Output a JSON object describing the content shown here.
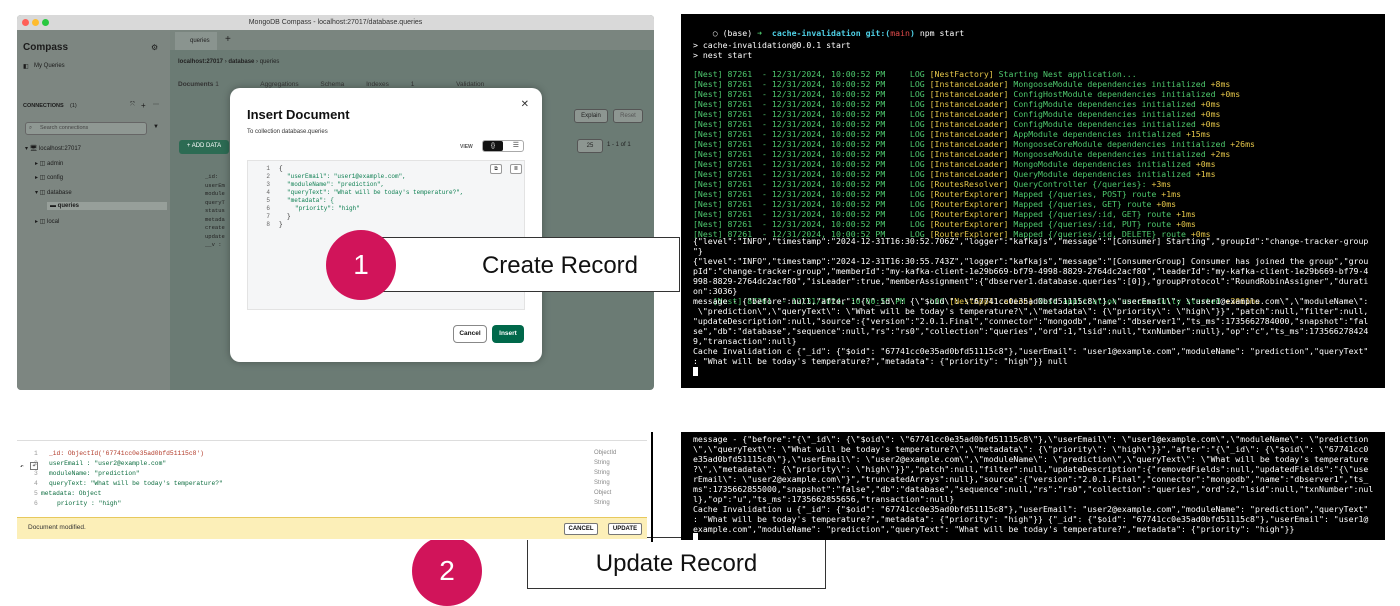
{
  "compass": {
    "window_title": "MongoDB Compass - localhost:27017/database.queries",
    "app_name": "Compass",
    "my_queries": "My Queries",
    "connections_label": "CONNECTIONS",
    "connections_count": "(1)",
    "search_placeholder": "Search connections",
    "tree": [
      "localhost:27017",
      "admin",
      "config",
      "database",
      "queries",
      "local"
    ],
    "tab": "queries",
    "breadcrumb": [
      "localhost:27017",
      "database",
      "queries"
    ],
    "subtabs": [
      "Documents",
      "1",
      "Aggregations",
      "Schema",
      "Indexes",
      "1",
      "Validation"
    ],
    "explain": "Explain",
    "reset": "Reset",
    "add_data": "ADD DATA",
    "page_size": "25",
    "page_info": "1 - 1 of 1",
    "bg_fields": [
      "_id:",
      "userEm",
      "module",
      "queryT",
      "status",
      "metada",
      "create",
      "update",
      "__v :"
    ]
  },
  "modal": {
    "title": "Insert Document",
    "subtitle": "To collection database.queries",
    "view_label": "VIEW",
    "view_json": "{}",
    "view_list": "☰",
    "line_numbers": [
      "1",
      "2",
      "3",
      "4",
      "5",
      "6",
      "7",
      "8"
    ],
    "code": [
      "{",
      "\"userEmail\": \"user1@example.com\",",
      "\"moduleName\": \"prediction\",",
      "\"queryText\": \"What will be today's temperature?\",",
      "\"metadata\": {",
      "\"priority\": \"high\"",
      "}",
      "}"
    ],
    "cancel": "Cancel",
    "insert": "Insert"
  },
  "labels": {
    "step1_num": "1",
    "step1_text": "Create Record",
    "step2_num": "2",
    "step2_text": "Update Record"
  },
  "terminal1": {
    "prompt_base": "(base)",
    "prompt_arrow": "➜",
    "prompt_dir": "cache-invalidation",
    "prompt_git": "git:(",
    "prompt_branch": "main",
    "prompt_git_end": ")",
    "prompt_cmd": "npm start",
    "out1": "> cache-invalidation@0.0.1 start",
    "out2": "> nest start",
    "logs": [
      [
        "[Nest] 87261  - 12/31/2024, 10:00:52 PM     LOG ",
        "[NestFactory]",
        " Starting Nest application...",
        ""
      ],
      [
        "[Nest] 87261  - 12/31/2024, 10:00:52 PM     LOG ",
        "[InstanceLoader]",
        " MongooseModule dependencies initialized",
        " +8ms"
      ],
      [
        "[Nest] 87261  - 12/31/2024, 10:00:52 PM     LOG ",
        "[InstanceLoader]",
        " ConfigHostModule dependencies initialized",
        " +0ms"
      ],
      [
        "[Nest] 87261  - 12/31/2024, 10:00:52 PM     LOG ",
        "[InstanceLoader]",
        " ConfigModule dependencies initialized",
        " +0ms"
      ],
      [
        "[Nest] 87261  - 12/31/2024, 10:00:52 PM     LOG ",
        "[InstanceLoader]",
        " ConfigModule dependencies initialized",
        " +0ms"
      ],
      [
        "[Nest] 87261  - 12/31/2024, 10:00:52 PM     LOG ",
        "[InstanceLoader]",
        " ConfigModule dependencies initialized",
        " +0ms"
      ],
      [
        "[Nest] 87261  - 12/31/2024, 10:00:52 PM     LOG ",
        "[InstanceLoader]",
        " AppModule dependencies initialized",
        " +15ms"
      ],
      [
        "[Nest] 87261  - 12/31/2024, 10:00:52 PM     LOG ",
        "[InstanceLoader]",
        " MongooseCoreModule dependencies initialized",
        " +26ms"
      ],
      [
        "[Nest] 87261  - 12/31/2024, 10:00:52 PM     LOG ",
        "[InstanceLoader]",
        " MongooseModule dependencies initialized",
        " +2ms"
      ],
      [
        "[Nest] 87261  - 12/31/2024, 10:00:52 PM     LOG ",
        "[InstanceLoader]",
        " MongoModule dependencies initialized",
        " +0ms"
      ],
      [
        "[Nest] 87261  - 12/31/2024, 10:00:52 PM     LOG ",
        "[InstanceLoader]",
        " QueryModule dependencies initialized",
        " +1ms"
      ],
      [
        "[Nest] 87261  - 12/31/2024, 10:00:52 PM     LOG ",
        "[RoutesResolver]",
        " QueryController {/queries}:",
        " +3ms"
      ],
      [
        "[Nest] 87261  - 12/31/2024, 10:00:52 PM     LOG ",
        "[RouterExplorer]",
        " Mapped {/queries, POST} route",
        " +1ms"
      ],
      [
        "[Nest] 87261  - 12/31/2024, 10:00:52 PM     LOG ",
        "[RouterExplorer]",
        " Mapped {/queries, GET} route",
        " +0ms"
      ],
      [
        "[Nest] 87261  - 12/31/2024, 10:00:52 PM     LOG ",
        "[RouterExplorer]",
        " Mapped {/queries/:id, GET} route",
        " +1ms"
      ],
      [
        "[Nest] 87261  - 12/31/2024, 10:00:52 PM     LOG ",
        "[RouterExplorer]",
        " Mapped {/queries/:id, PUT} route",
        " +0ms"
      ],
      [
        "[Nest] 87261  - 12/31/2024, 10:00:52 PM     LOG ",
        "[RouterExplorer]",
        " Mapped {/queries/:id, DELETE} route",
        " +0ms"
      ]
    ],
    "json_lines": [
      "{\"level\":\"INFO\",\"timestamp\":\"2024-12-31T16:30:52.706Z\",\"logger\":\"kafkajs\",\"message\":\"[Consumer] Starting\",\"groupId\":\"change-tracker-group",
      "\"}",
      "{\"level\":\"INFO\",\"timestamp\":\"2024-12-31T16:30:55.743Z\",\"logger\":\"kafkajs\",\"message\":\"[ConsumerGroup] Consumer has joined the group\",\"grou",
      "pId\":\"change-tracker-group\",\"memberId\":\"my-kafka-client-1e29b669-bf79-4998-8829-2764dc2acf80\",\"leaderId\":\"my-kafka-client-1e29b669-bf79-4",
      "998-8829-2764dc2acf80\",\"isLeader\":true,\"memberAssignment\":{\"dbserver1.database.queries\":[0]},\"groupProtocol\":\"RoundRobinAssigner\",\"durati",
      "on\":3036}"
    ],
    "app_started": [
      "[Nest] 87261  - 12/31/2024, 10:00:55 PM     LOG ",
      "[NestApplication]",
      " Nest application successfully started",
      " +3061ms"
    ],
    "msg_lines": [
      "message - {\"before\":null,\"after\":\"{\\\"_id\\\": {\\\"$oid\\\": \\\"67741cc0e35ad0bfd51115c8\\\"},\\\"userEmail\\\": \\\"user1@example.com\\\",\\\"moduleName\\\":",
      " \\\"prediction\\\",\\\"queryText\\\": \\\"What will be today's temperature?\\\",\\\"metadata\\\": {\\\"priority\\\": \\\"high\\\"}}\",\"patch\":null,\"filter\":null,",
      "\"updateDescription\":null,\"source\":{\"version\":\"2.0.1.Final\",\"connector\":\"mongodb\",\"name\":\"dbserver1\",\"ts_ms\":1735662784000,\"snapshot\":\"fal",
      "se\",\"db\":\"database\",\"sequence\":null,\"rs\":\"rs0\",\"collection\":\"queries\",\"ord\":1,\"lsid\":null,\"txnNumber\":null},\"op\":\"c\",\"ts_ms\":173566278424",
      "9,\"transaction\":null}",
      "Cache Invalidation c {\"_id\": {\"$oid\": \"67741cc0e35ad0bfd51115c8\"},\"userEmail\": \"user1@example.com\",\"moduleName\": \"prediction\",\"queryText\"",
      ": \"What will be today's temperature?\",\"metadata\": {\"priority\": \"high\"}} null"
    ]
  },
  "doc": {
    "fields": [
      {
        "ln": "1",
        "text": "_id: ObjectId('67741cc0e35ad0bfd51115c8')",
        "type": "ObjectId"
      },
      {
        "ln": "2",
        "text": "userEmail : \"user2@example.com\"",
        "type": "String"
      },
      {
        "ln": "3",
        "text": "moduleName: \"prediction\"",
        "type": "String"
      },
      {
        "ln": "4",
        "text": "queryText: \"What will be today's temperature?\"",
        "type": "String"
      },
      {
        "ln": "5",
        "text": "metadata: Object",
        "type": "Object"
      },
      {
        "ln": "6",
        "text": "priority : \"high\"",
        "type": "String"
      }
    ],
    "modified": "Document modified.",
    "cancel": "CANCEL",
    "update": "UPDATE"
  },
  "terminal2": {
    "lines": [
      "message - {\"before\":\"{\\\"_id\\\": {\\\"$oid\\\": \\\"67741cc0e35ad0bfd51115c8\\\"},\\\"userEmail\\\": \\\"user1@example.com\\\",\\\"moduleName\\\": \\\"prediction",
      "\\\",\\\"queryText\\\": \\\"What will be today's temperature?\\\",\\\"metadata\\\": {\\\"priority\\\": \\\"high\\\"}}\",\"after\":\"{\\\"_id\\\": {\\\"$oid\\\": \\\"67741cc0",
      "e35ad0bfd51115c8\\\"},\\\"userEmail\\\": \\\"user2@example.com\\\",\\\"moduleName\\\": \\\"prediction\\\",\\\"queryText\\\": \\\"What will be today's temperature",
      "?\\\",\\\"metadata\\\": {\\\"priority\\\": \\\"high\\\"}}\",\"patch\":null,\"filter\":null,\"updateDescription\":{\"removedFields\":null,\"updatedFields\":\"{\\\"use",
      "rEmail\\\": \\\"user2@example.com\\\"}\",\"truncatedArrays\":null},\"source\":{\"version\":\"2.0.1.Final\",\"connector\":\"mongodb\",\"name\":\"dbserver1\",\"ts_",
      "ms\":1735662855000,\"snapshot\":\"false\",\"db\":\"database\",\"sequence\":null,\"rs\":\"rs0\",\"collection\":\"queries\",\"ord\":2,\"lsid\":null,\"txnNumber\":nul",
      "l},\"op\":\"u\",\"ts_ms\":1735662855656,\"transaction\":null}",
      "Cache Invalidation u {\"_id\": {\"$oid\": \"67741cc0e35ad0bfd51115c8\"},\"userEmail\": \"user2@example.com\",\"moduleName\": \"prediction\",\"queryText\"",
      ": \"What will be today's temperature?\",\"metadata\": {\"priority\": \"high\"}} {\"_id\": {\"$oid\": \"67741cc0e35ad0bfd51115c8\"},\"userEmail\": \"user1@",
      "example.com\",\"moduleName\": \"prediction\",\"queryText\": \"What will be today's temperature?\",\"metadata\": {\"priority\": \"high\"}}"
    ]
  },
  "colors": {
    "accent": "#00684a",
    "badge": "#d1145a",
    "term_bg": "#000000",
    "log_green": "#4ec96e",
    "log_yellow": "#e5c64a"
  }
}
